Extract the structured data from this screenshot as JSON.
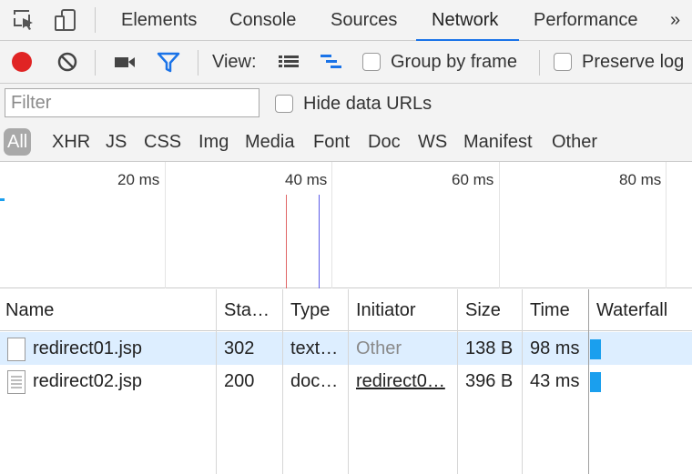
{
  "tabs": {
    "items": [
      "Elements",
      "Console",
      "Sources",
      "Network",
      "Performance"
    ],
    "active": "Network",
    "more": "»"
  },
  "toolbar": {
    "view_label": "View:",
    "group_by_frame": "Group by frame",
    "preserve_log": "Preserve log",
    "record_color": "#e02424",
    "filter_icon_color": "#1a73e8"
  },
  "filter": {
    "placeholder": "Filter",
    "value": "",
    "hide_data_urls": "Hide data URLs"
  },
  "types": [
    "All",
    "XHR",
    "JS",
    "CSS",
    "Img",
    "Media",
    "Font",
    "Doc",
    "WS",
    "Manifest",
    "Other"
  ],
  "overview": {
    "ticks": [
      "20 ms",
      "40 ms",
      "60 ms",
      "80 ms"
    ],
    "dom_content_loaded_color": "#5b5be8",
    "load_color": "#e06666"
  },
  "table": {
    "columns": [
      "Name",
      "Sta…",
      "Type",
      "Initiator",
      "Size",
      "Time",
      "Waterfall"
    ],
    "rows": [
      {
        "name": "redirect01.jsp",
        "status": "302",
        "type": "text…",
        "initiator": "Other",
        "size": "138 B",
        "time": "98 ms",
        "selected": true
      },
      {
        "name": "redirect02.jsp",
        "status": "200",
        "type": "doc…",
        "initiator": "redirect0…",
        "size": "396 B",
        "time": "43 ms",
        "selected": false
      }
    ]
  }
}
